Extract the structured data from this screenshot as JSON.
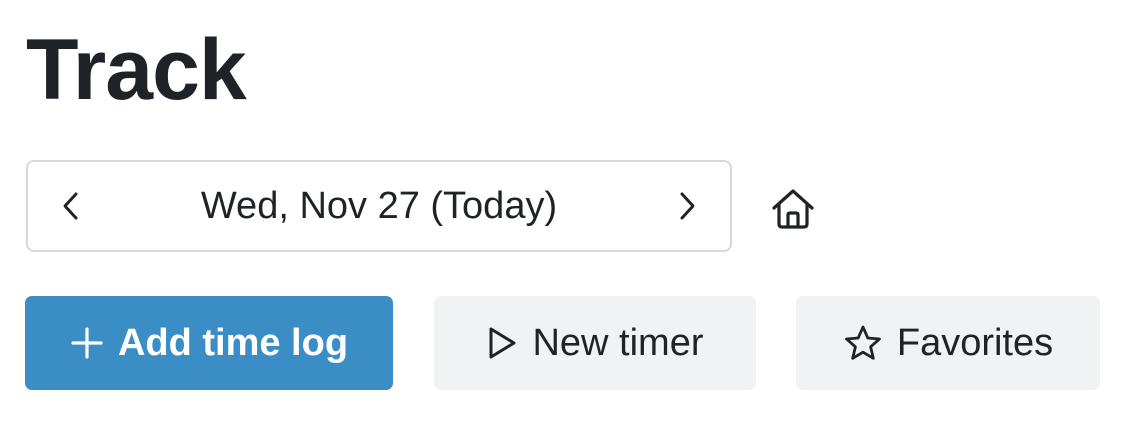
{
  "page": {
    "title": "Track"
  },
  "date_nav": {
    "date_label": "Wed, Nov 27 (Today)",
    "prev_icon": "chevron-left-icon",
    "next_icon": "chevron-right-icon"
  },
  "home_button": {
    "icon": "home-icon"
  },
  "actions": {
    "add_time_log": {
      "label": "Add time log",
      "icon": "plus-icon"
    },
    "new_timer": {
      "label": "New timer",
      "icon": "play-icon"
    },
    "favorites": {
      "label": "Favorites",
      "icon": "star-icon"
    }
  },
  "colors": {
    "primary": "#3a8ec5",
    "secondary_bg": "#f1f2f4",
    "text": "#1f2328",
    "border": "#d6d8dc"
  }
}
